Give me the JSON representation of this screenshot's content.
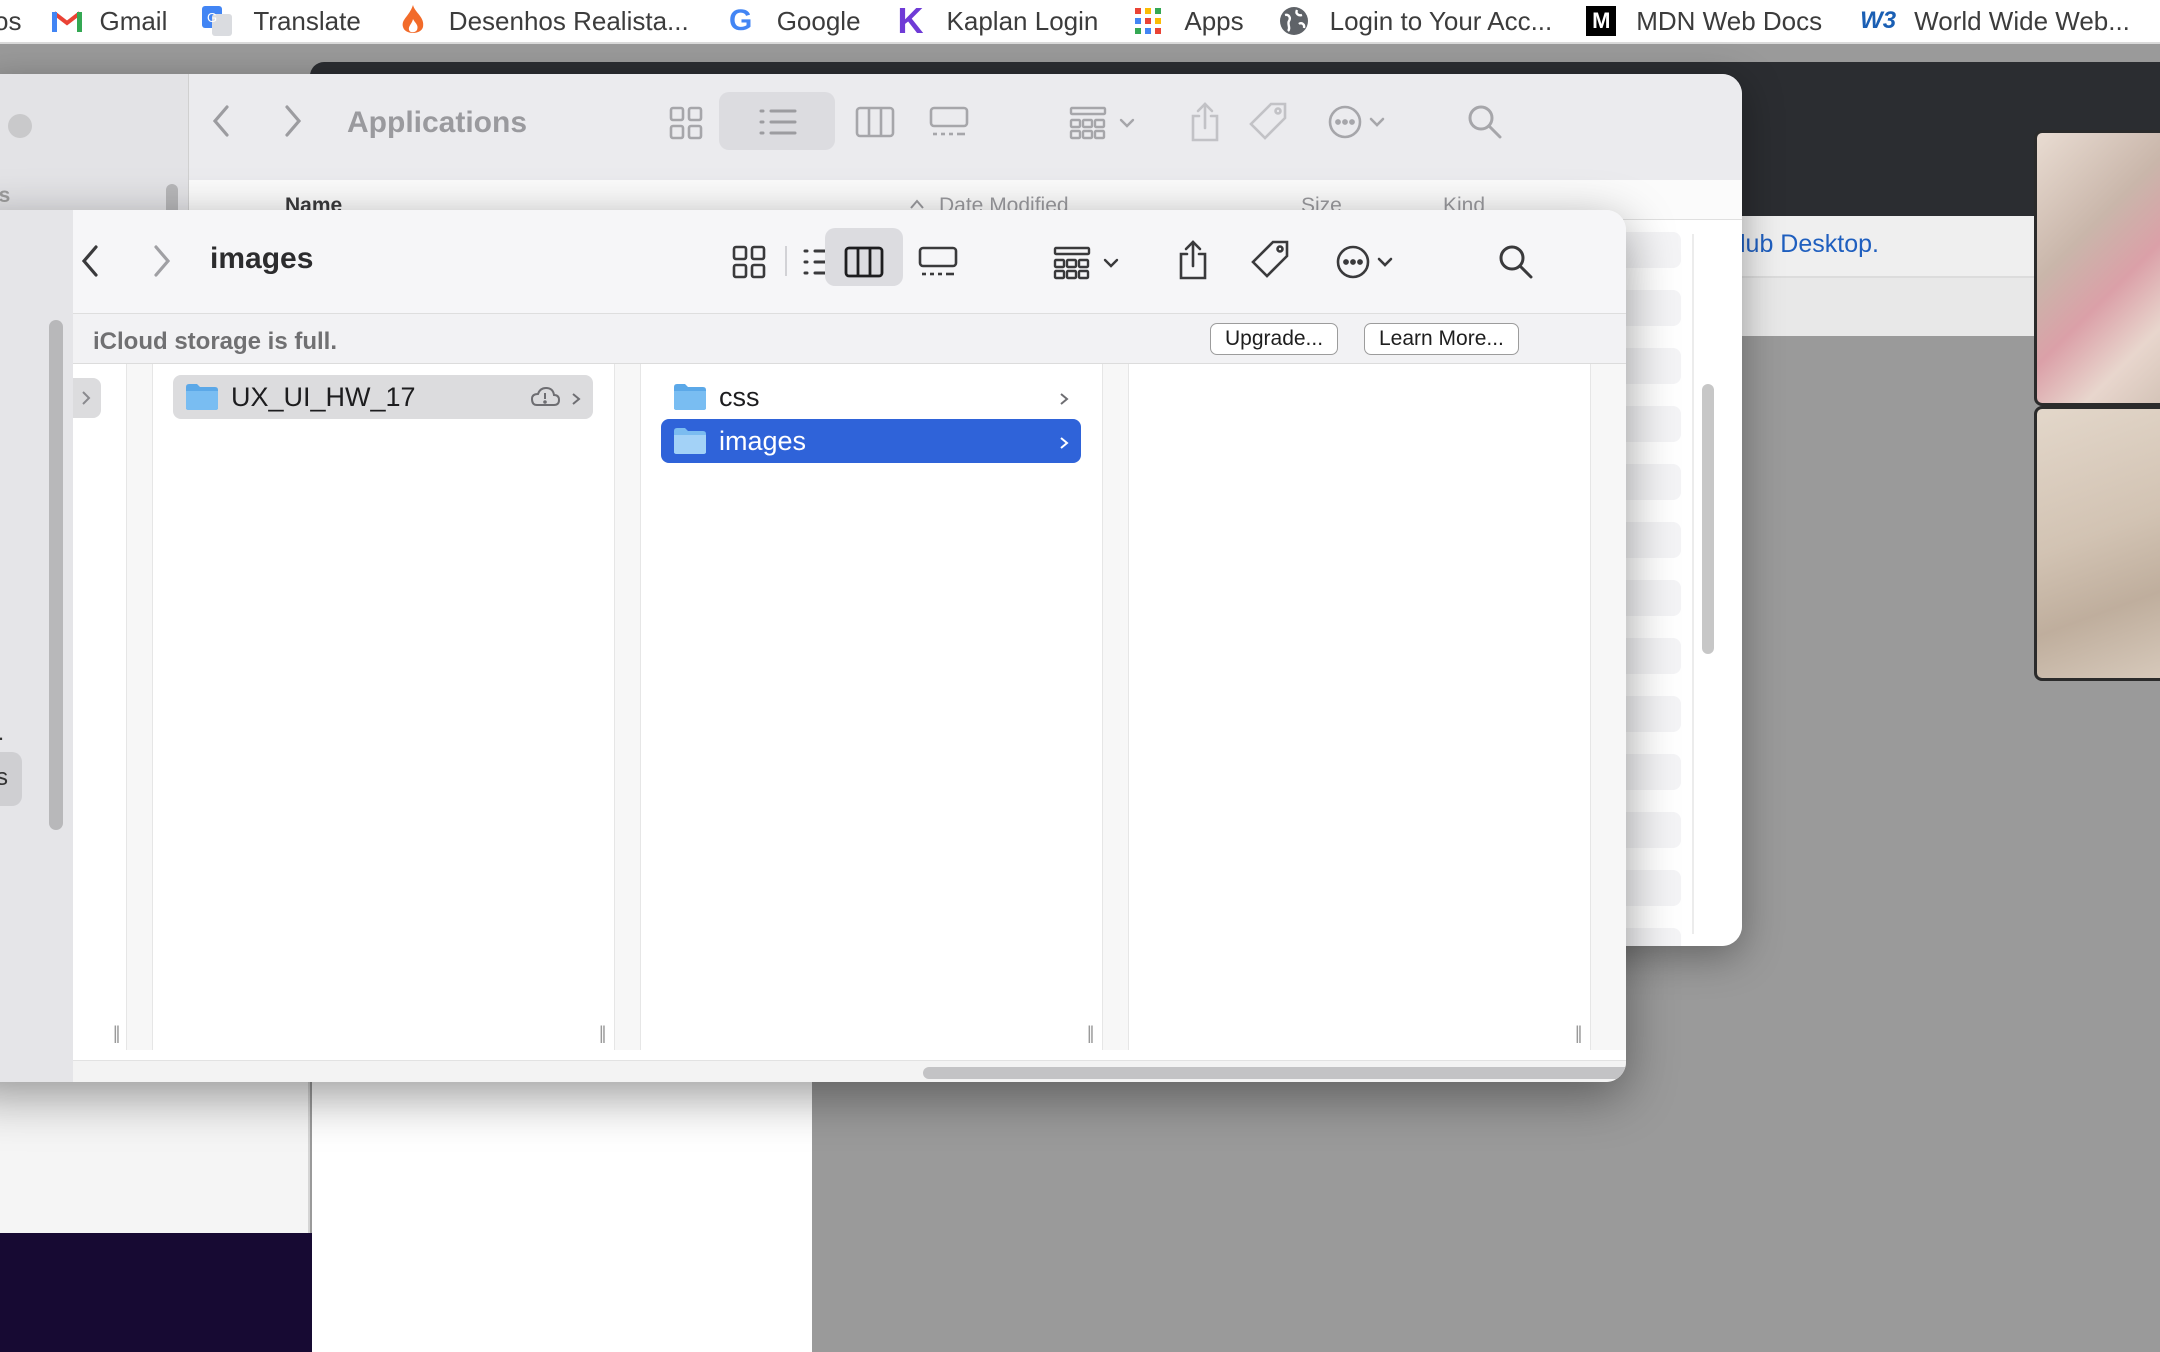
{
  "bookmarks": [
    {
      "label": "os",
      "icon": "partial-icon"
    },
    {
      "label": "Gmail",
      "icon": "gmail-icon"
    },
    {
      "label": "Translate",
      "icon": "google-translate-icon"
    },
    {
      "label": "Desenhos Realista...",
      "icon": "flame-icon"
    },
    {
      "label": "Google",
      "icon": "google-icon"
    },
    {
      "label": "Kaplan Login",
      "icon": "kaplan-icon"
    },
    {
      "label": "Apps",
      "icon": "apps-grid-icon"
    },
    {
      "label": "Login to Your Acc...",
      "icon": "globe-icon"
    },
    {
      "label": "MDN Web Docs",
      "icon": "mdn-icon"
    },
    {
      "label": "World Wide Web...",
      "icon": "w3c-icon"
    }
  ],
  "background": {
    "github_text": "lub Desktop."
  },
  "back_window": {
    "title": "Applications",
    "sidebar_partial_label": "tes",
    "columns": {
      "name": "Name",
      "date": "Date Modified",
      "size": "Size",
      "kind": "Kind"
    }
  },
  "front_window": {
    "title": "images",
    "banner": {
      "text": "iCloud storage is full.",
      "upgrade": "Upgrade...",
      "learn_more": "Learn More..."
    },
    "sidebar_partial": "s",
    "columns": [
      {
        "items": [
          {
            "name": "UX_UI_HW_17",
            "state": "dim-selected",
            "cloud": true,
            "chevron": true
          }
        ]
      },
      {
        "items": [
          {
            "name": "css",
            "state": "normal",
            "chevron": true
          },
          {
            "name": "images",
            "state": "selected",
            "chevron": true
          }
        ]
      },
      {
        "items": []
      }
    ]
  },
  "colors": {
    "selection_blue": "#2f63d9",
    "link_blue": "#1f5fbf"
  }
}
